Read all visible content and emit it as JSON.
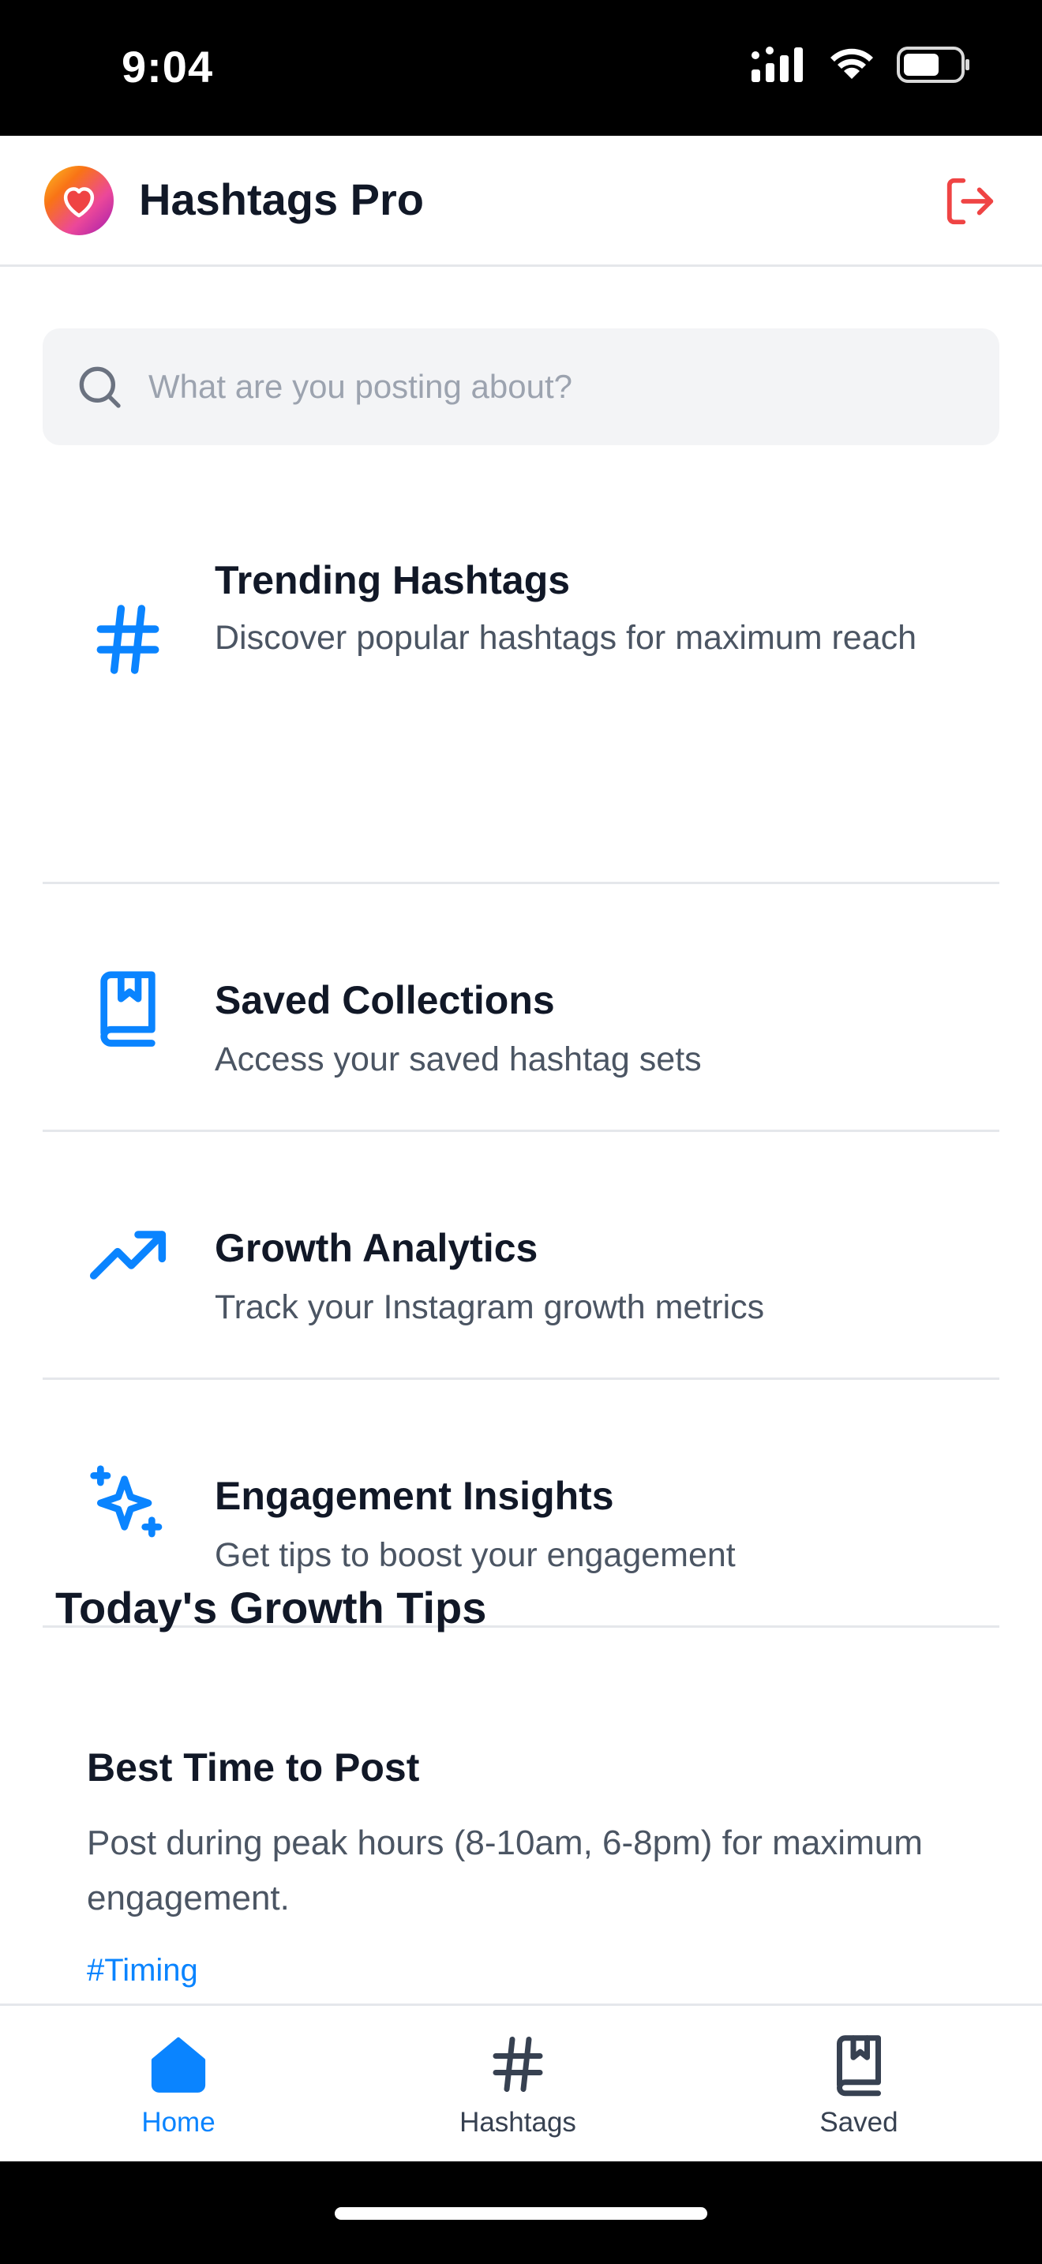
{
  "status_bar": {
    "time": "9:04",
    "signal_icon": "signal-bars-icon",
    "wifi_icon": "wifi-icon",
    "battery_icon": "battery-icon"
  },
  "header": {
    "title": "Hashtags Pro",
    "logo_icon": "heart-icon",
    "logout_icon": "logout-icon",
    "logout_color": "#ef4444"
  },
  "search": {
    "placeholder": "What are you posting about?",
    "value": ""
  },
  "features": [
    {
      "icon": "hashtag-icon",
      "title": "Trending Hashtags",
      "description": "Discover popular hashtags for maximum reach"
    },
    {
      "icon": "bookmark-book-icon",
      "title": "Saved Collections",
      "description": "Access your saved hashtag sets"
    },
    {
      "icon": "trending-up-icon",
      "title": "Growth Analytics",
      "description": "Track your Instagram growth metrics"
    },
    {
      "icon": "sparkles-icon",
      "title": "Engagement Insights",
      "description": "Get tips to boost your engagement"
    }
  ],
  "tips_section": {
    "title": "Today's Growth Tips",
    "tips": [
      {
        "title": "Best Time to Post",
        "body": "Post during peak hours (8-10am, 6-8pm) for maximum engagement.",
        "tag": "#Timing"
      }
    ]
  },
  "tabbar": {
    "tabs": [
      {
        "label": "Home",
        "icon": "home-icon",
        "active": true
      },
      {
        "label": "Hashtags",
        "icon": "hashtag-icon",
        "active": false
      },
      {
        "label": "Saved",
        "icon": "bookmark-book-icon",
        "active": false
      }
    ]
  },
  "colors": {
    "accent": "#0a84ff",
    "text_primary": "#111827",
    "text_secondary": "#4b5563",
    "divider": "#e5e7eb",
    "search_bg": "#f3f4f6"
  }
}
